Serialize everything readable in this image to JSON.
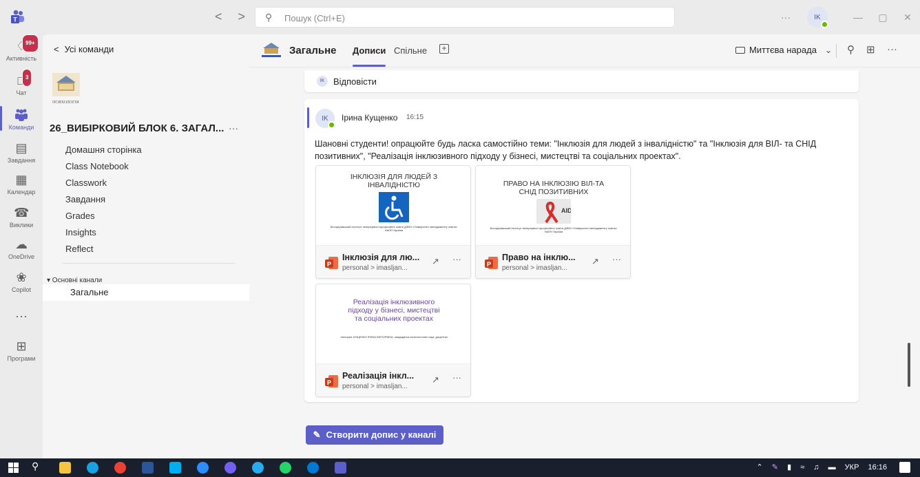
{
  "app": {
    "search_placeholder": "Пошук (Ctrl+E)",
    "nav_back": "<",
    "nav_forward": ">",
    "more": "···",
    "user_initials": "IK",
    "win_minimize": "—",
    "win_maximize": "▢",
    "win_close": "✕"
  },
  "rail": [
    {
      "label": "Активність",
      "icon": "bell-icon",
      "badge": "99+"
    },
    {
      "label": "Чат",
      "icon": "chat-icon",
      "badge": "3"
    },
    {
      "label": "Команди",
      "icon": "teams-icon",
      "active": true
    },
    {
      "label": "Завдання",
      "icon": "assignments-icon"
    },
    {
      "label": "Календар",
      "icon": "calendar-icon"
    },
    {
      "label": "Виклики",
      "icon": "phone-icon"
    },
    {
      "label": "OneDrive",
      "icon": "cloud-icon"
    },
    {
      "label": "Copilot",
      "icon": "copilot-icon"
    },
    {
      "label": "",
      "icon": "more-icon",
      "glyph": "···"
    },
    {
      "label": "Програми",
      "icon": "add-apps-icon"
    }
  ],
  "sidebar": {
    "back_label": "Усі команди",
    "team_name": "26_ВИБІРКОВИЙ БЛОК 6. ЗАГАЛ...",
    "team_more": "···",
    "nav": [
      "Домашня сторінка",
      "Class Notebook",
      "Classwork",
      "Завдання",
      "Grades",
      "Insights",
      "Reflect"
    ],
    "section_label": "▾ Основні канали",
    "channel": "Загальне"
  },
  "header": {
    "channel_title": "Загальне",
    "tabs": [
      "Дописи",
      "Спільне"
    ],
    "add_tab": "+",
    "meet_label": "Миттєва нарада",
    "meet_chevron": "⌄"
  },
  "reply": {
    "initials": "IK",
    "label": "Відповісти"
  },
  "post": {
    "initials": "IK",
    "author": "Ірина Кущенко",
    "time": "16:15",
    "text": "Шановні студенти! опрацюйте будь ласка самостійно теми: \"Інклюзія для людей з інвалідністю\" та \"Інклюзія для ВІЛ- та СНІД позитивних\", \"Реалізація інклюзивного підходу у бізнесі, мистецтві та соціальних проектах\".",
    "files": [
      {
        "preview_title": "ІНКЛЮЗІЯ ДЛЯ ЛЮДЕЙ З ІНВАЛІДНІСТЮ",
        "preview_footer": "Білоцерківський інститут неперервної професійної освіти ДЗВО «Університет менеджменту освіти» НАПН України",
        "name": "Інклюзія для лю...",
        "path": "personal > imasljan..."
      },
      {
        "preview_title": "ПРАВО НА ІНКЛЮЗІЮ ВІЛ-ТА СНІД ПОЗИТИВНИХ",
        "preview_footer": "Білоцерківський інститут неперервної професійної освіти ДЗВО «Університет менеджменту освіти» НАПН України",
        "name": "Право на інклю...",
        "path": "personal > imasljan..."
      },
      {
        "preview_title": "Реалізація інклюзивного підходу у бізнесі, мистецтві та соціальних проектах",
        "preview_footer": "лекторка: КУЩЕНКО ІРИНА ВІКТОРІВНА, кандидатка психологічних наук, доцентка",
        "name": "Реалізація інкл...",
        "path": "personal > imasljan..."
      }
    ]
  },
  "compose_label": "Створити допис у каналі",
  "taskbar": {
    "language": "УКР",
    "time": "16:16"
  },
  "colors": {
    "accent": "#5b5fc7",
    "badge": "#c4314b",
    "ppt": "#c43e1c",
    "online": "#6bb700"
  }
}
